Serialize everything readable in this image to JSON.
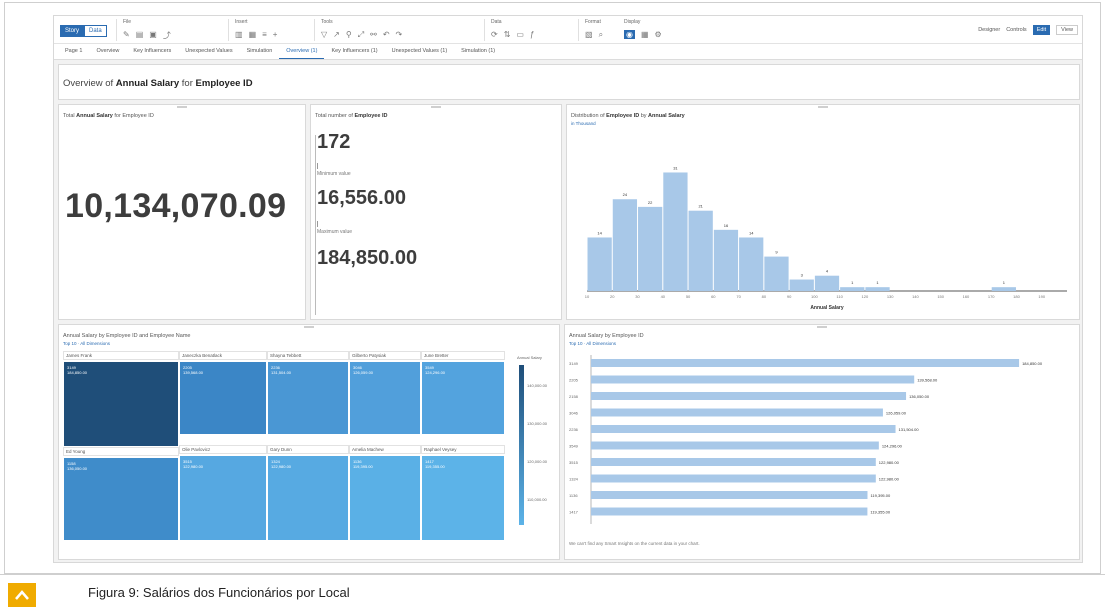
{
  "toolbar": {
    "mode_story": "Story",
    "mode_data": "Data",
    "groups": [
      "File",
      "Insert",
      "Tools",
      "Data",
      "Format",
      "Display"
    ],
    "designer": "Designer",
    "controls": "Controls",
    "edit": "Edit",
    "view": "View"
  },
  "tabs": [
    "Page 1",
    "Overview",
    "Key Influencers",
    "Unexpected Values",
    "Simulation",
    "Overview (1)",
    "Key Influencers (1)",
    "Unexpected Values (1)",
    "Simulation (1)"
  ],
  "active_tab": "Overview (1)",
  "header": {
    "prefix": "Overview of ",
    "measure": "Annual Salary",
    "mid": " for ",
    "dimension": "Employee ID"
  },
  "total_card": {
    "title_prefix": "Total ",
    "title_bold": "Annual Salary",
    "title_suffix": " for Employee ID",
    "value": "10,134,070.09"
  },
  "kpi_card": {
    "title_prefix": "Total number of ",
    "title_bold": "Employee ID",
    "count": "172",
    "min_label": "Minimum value",
    "min": "16,556.00",
    "max_label": "Maximum value",
    "max": "184,850.00"
  },
  "histogram": {
    "title_prefix": "Distribution of ",
    "title_bold1": "Employee ID",
    "title_mid": " by ",
    "title_bold2": "Annual Salary",
    "subtitle": "in Thousand",
    "xlabel": "Annual Salary",
    "chart_data": {
      "type": "bar",
      "categories": [
        "10",
        "20",
        "30",
        "40",
        "50",
        "60",
        "70",
        "80",
        "90",
        "100",
        "110",
        "120",
        "130",
        "140",
        "150",
        "160",
        "170",
        "180",
        "190"
      ],
      "values": [
        14,
        24,
        22,
        31,
        21,
        16,
        14,
        9,
        3,
        4,
        1,
        1,
        0,
        0,
        0,
        0,
        1,
        0,
        0
      ],
      "xlabel": "Annual Salary",
      "ylim": [
        0,
        34
      ]
    }
  },
  "treemap": {
    "title": "Annual Salary by Employee ID and Employee Name",
    "subtitle": "Top 10 · All Dimensions",
    "legend_title": "Annual Salary",
    "legend_ticks": [
      "140,000.00",
      "130,000.00",
      "120,000.00",
      "110,000.00"
    ],
    "cells": [
      {
        "name": "James Frank",
        "id": "3149",
        "value": "184,850.00",
        "color": "#1f4e79"
      },
      {
        "name": "Janeczka Benatlack",
        "id": "2205",
        "value": "139,568.00",
        "color": "#3b86c6"
      },
      {
        "name": "Shayna Tebbett",
        "id": "2236",
        "value": "131,504.00",
        "color": "#4a97d4"
      },
      {
        "name": "Gilberto Patysiak",
        "id": "3046",
        "value": "126,059.00",
        "color": "#519fdb"
      },
      {
        "name": "June Bretter",
        "id": "3549",
        "value": "124,296.00",
        "color": "#53a3de"
      },
      {
        "name": "Ed Young",
        "id": "1158",
        "value": "136,050.00",
        "color": "#3f8cca"
      },
      {
        "name": "Olie Pavlovicz",
        "id": "3515",
        "value": "122,980.00",
        "color": "#56a8e1"
      },
      {
        "name": "Gary Dunn",
        "id": "1324",
        "value": "122,980.00",
        "color": "#57aae2"
      },
      {
        "name": "Amelia Machew",
        "id": "1136",
        "value": "119,395.00",
        "color": "#5ab0e6"
      },
      {
        "name": "Raphael Veysey",
        "id": "1417",
        "value": "119,355.00",
        "color": "#5cb3e8"
      }
    ]
  },
  "hbar": {
    "title": "Annual Salary by Employee ID",
    "subtitle": "Top 10 · All Dimensions",
    "note": "We can't find any Smart Insights on the current data in your chart.",
    "chart_data": {
      "type": "bar",
      "orientation": "horizontal",
      "categories": [
        "3149",
        "2205",
        "2158",
        "3046",
        "2236",
        "3549",
        "3515",
        "1324",
        "1136",
        "1417"
      ],
      "values": [
        184850,
        139568,
        136050,
        126059,
        131504,
        124296,
        122980,
        122980,
        119395,
        119355
      ],
      "labels": [
        "184,850.00",
        "139,568.00",
        "136,050.00",
        "126,059.00",
        "131,504.00",
        "124,296.00",
        "122,980.00",
        "122,980.00",
        "119,395.00",
        "119,355.00"
      ],
      "xlim": [
        0,
        190000
      ]
    }
  },
  "footer": {
    "caption": "Figura 9: Salários dos Funcionários por Local",
    "accent": "#f0ab00"
  },
  "colors": {
    "bar": "#a8c8e8",
    "accent": "#2a6bb1"
  }
}
